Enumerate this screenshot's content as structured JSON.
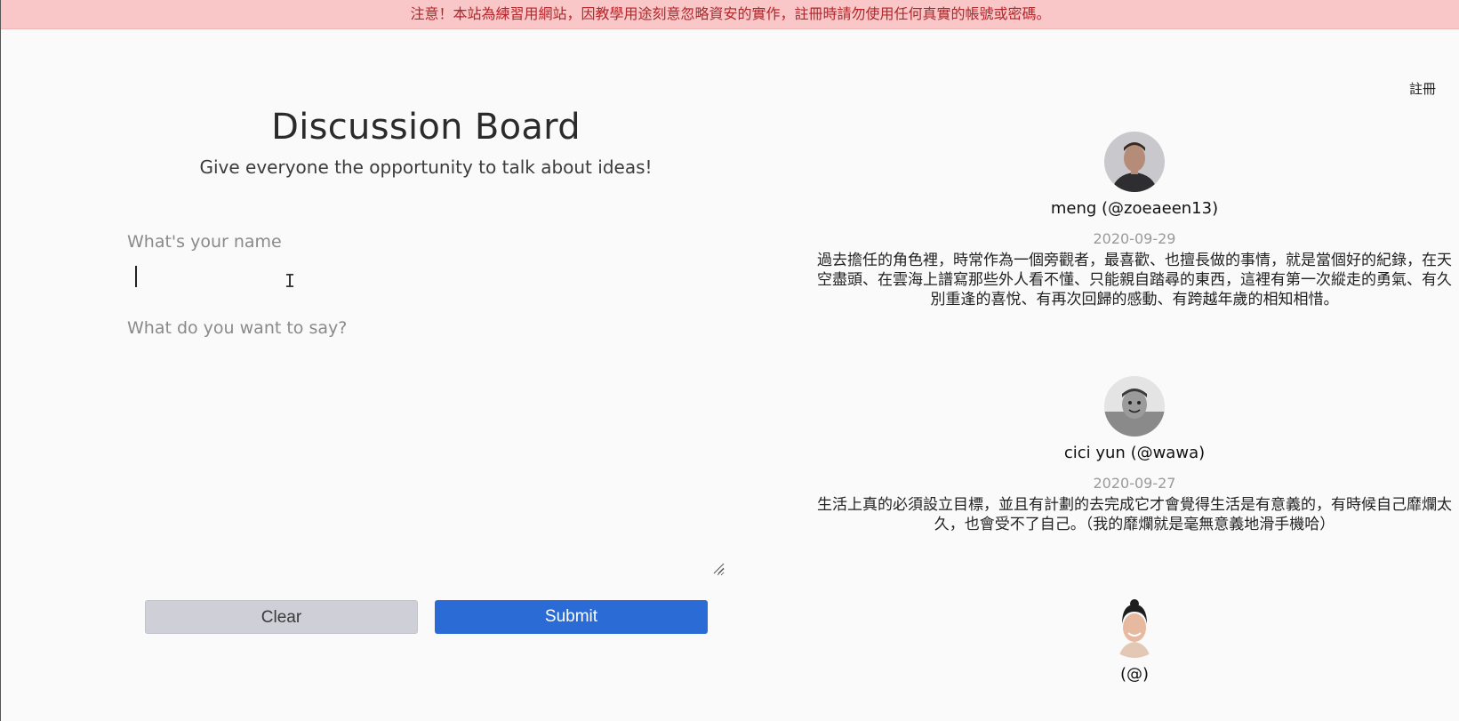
{
  "banner": {
    "text": "注意！本站為練習用網站，因教學用途刻意忽略資安的實作，註冊時請勿使用任何真實的帳號或密碼。"
  },
  "nav": {
    "register_label": "註冊"
  },
  "form": {
    "title": "Discussion Board",
    "subtitle": "Give everyone the opportunity to talk about ideas!",
    "name_label": "What's your name",
    "name_value": "",
    "message_label": "What do you want to say?",
    "message_value": "",
    "clear_label": "Clear",
    "submit_label": "Submit"
  },
  "posts": [
    {
      "author": "meng (@zoeaeen13)",
      "date": "2020-09-29",
      "body": "過去擔任的角色裡，時常作為一個旁觀者，最喜歡、也擅長做的事情，就是當個好的紀錄，在天空盡頭、在雲海上譜寫那些外人看不懂、只能親自踏尋的東西，這裡有第一次縱走的勇氣、有久別重逢的喜悅、有再次回歸的感動、有跨越年歲的相知相惜。",
      "avatar_icon": "avatar-man-photo"
    },
    {
      "author": "cici yun (@wawa)",
      "date": "2020-09-27",
      "body": "生活上真的必須設立目標，並且有計劃的去完成它才會覺得生活是有意義的，有時候自己靡爛太久，也會受不了自己。（我的靡爛就是毫無意義地滑手機哈）",
      "avatar_icon": "avatar-child-photo"
    },
    {
      "author": "(@)",
      "date": "",
      "body": "",
      "avatar_icon": "avatar-woman-photo"
    }
  ],
  "colors": {
    "banner_bg": "#f9c7c7",
    "banner_text": "#b3262b",
    "submit_bg": "#2b6bd6",
    "clear_bg": "#cfcfd7",
    "page_bg": "#fafafa"
  }
}
